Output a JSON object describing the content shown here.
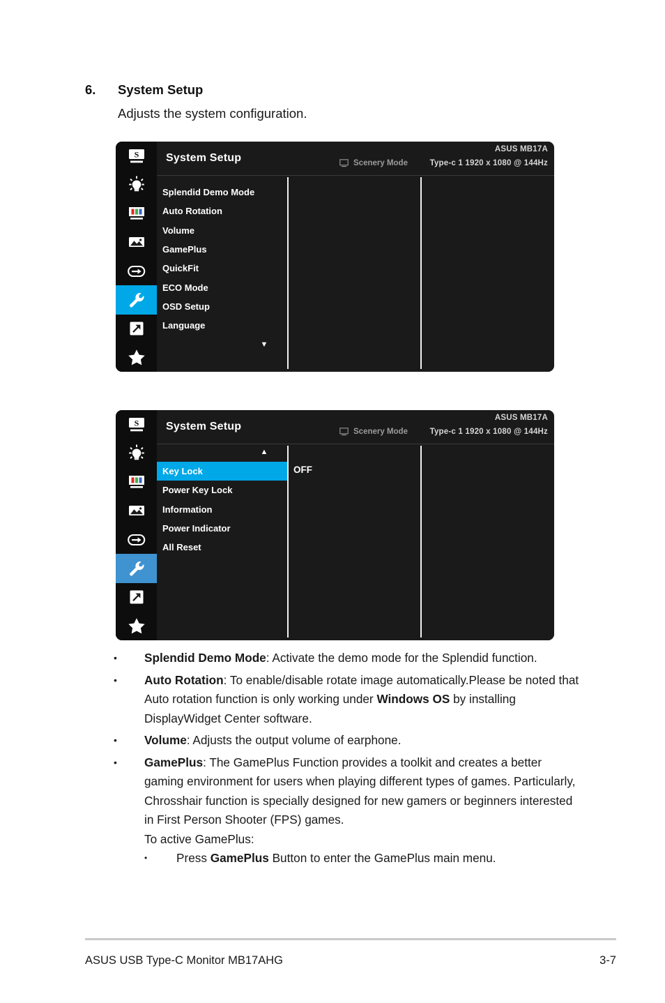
{
  "page": {
    "section_number": "6.",
    "section_title": "System Setup",
    "section_subtitle": "Adjusts the system configuration."
  },
  "osd_menus": [
    {
      "title": "System Setup",
      "mode_label": "Scenery Mode",
      "mode_icon": "monitor-icon",
      "brand": "ASUS MB17A",
      "resolution": "Type-c 1  1920 x 1080 @ 144Hz",
      "sidebar": [
        {
          "icon": "splendid-monitor-s-icon",
          "name": "splendid",
          "active": false
        },
        {
          "icon": "brightness-bulb-icon",
          "name": "eyecare",
          "active": false
        },
        {
          "icon": "color-bars-icon",
          "name": "color",
          "active": false
        },
        {
          "icon": "image-picture-icon",
          "name": "image",
          "active": false
        },
        {
          "icon": "input-select-icon",
          "name": "input-select",
          "active": false
        },
        {
          "icon": "wrench-icon",
          "name": "system-setup",
          "active": true
        },
        {
          "icon": "shortcut-arrow-icon",
          "name": "shortcut",
          "active": false
        },
        {
          "icon": "star-icon",
          "name": "myfavorite",
          "active": false
        }
      ],
      "items": [
        {
          "label": "Splendid Demo Mode",
          "selected": false
        },
        {
          "label": "Auto Rotation",
          "selected": false
        },
        {
          "label": "Volume",
          "selected": false
        },
        {
          "label": "GamePlus",
          "selected": false
        },
        {
          "label": "QuickFit",
          "selected": false
        },
        {
          "label": "ECO Mode",
          "selected": false
        },
        {
          "label": "OSD Setup",
          "selected": false
        },
        {
          "label": "Language",
          "selected": false
        }
      ],
      "scroll_down": "▼",
      "scroll_up": "",
      "value": ""
    },
    {
      "title": "System Setup",
      "mode_label": "Scenery Mode",
      "mode_icon": "monitor-icon",
      "brand": "ASUS MB17A",
      "resolution": "Type-c 1  1920 x 1080 @ 144Hz",
      "sidebar": [
        {
          "icon": "splendid-monitor-s-icon",
          "name": "splendid",
          "active": false
        },
        {
          "icon": "brightness-bulb-icon",
          "name": "eyecare",
          "active": false
        },
        {
          "icon": "color-bars-icon",
          "name": "color",
          "active": false
        },
        {
          "icon": "image-picture-icon",
          "name": "image",
          "active": false
        },
        {
          "icon": "input-select-icon",
          "name": "input-select",
          "active": false
        },
        {
          "icon": "wrench-icon",
          "name": "system-setup",
          "active": true
        },
        {
          "icon": "shortcut-arrow-icon",
          "name": "shortcut",
          "active": false
        },
        {
          "icon": "star-icon",
          "name": "myfavorite",
          "active": false
        }
      ],
      "items": [
        {
          "label": "Key Lock",
          "selected": true
        },
        {
          "label": "Power Key Lock",
          "selected": false
        },
        {
          "label": "Information",
          "selected": false
        },
        {
          "label": "Power Indicator",
          "selected": false
        },
        {
          "label": "All Reset",
          "selected": false
        }
      ],
      "scroll_down": "",
      "scroll_up": "▲",
      "value": "OFF"
    }
  ],
  "bullets": [
    {
      "marker": "•",
      "segments": [
        {
          "text": "Splendid Demo Mode",
          "bold": true
        },
        {
          "text": ": Activate the demo mode for the Splendid function.",
          "bold": false
        }
      ]
    },
    {
      "marker": "•",
      "segments": [
        {
          "text": "Auto Rotation",
          "bold": true
        },
        {
          "text": ": To enable/disable rotate image automatically.Please be noted that Auto rotation function is only working under ",
          "bold": false
        },
        {
          "text": "Windows OS",
          "bold": true
        },
        {
          "text": " by installing DisplayWidget Center software.",
          "bold": false
        }
      ]
    },
    {
      "marker": "•",
      "segments": [
        {
          "text": "Volume",
          "bold": true
        },
        {
          "text": ": Adjusts the output volume of earphone.",
          "bold": false
        }
      ]
    },
    {
      "marker": "•",
      "segments": [
        {
          "text": "GamePlus",
          "bold": true
        },
        {
          "text": ": The GamePlus Function provides a toolkit and creates a better gaming environment for users when playing different types of games. Particularly, Chrosshair function is specially designed for new gamers or beginners interested in First Person Shooter (FPS) games.",
          "bold": false
        }
      ]
    }
  ],
  "sub_text": "To active GamePlus:",
  "sub_bullet": {
    "marker": "•",
    "segments": [
      {
        "text": "Press ",
        "bold": false
      },
      {
        "text": "GamePlus",
        "bold": true
      },
      {
        "text": " Button to enter the GamePlus main menu.",
        "bold": false
      }
    ]
  },
  "footer": {
    "left": "ASUS USB Type-C Monitor MB17AHG",
    "right": "3-7"
  },
  "colors": {
    "highlight": "#00a8e8",
    "highlight_muted": "#3f93d0",
    "panel_bg": "#1a1a1a",
    "sidebar_bg": "#0d0d0d"
  }
}
